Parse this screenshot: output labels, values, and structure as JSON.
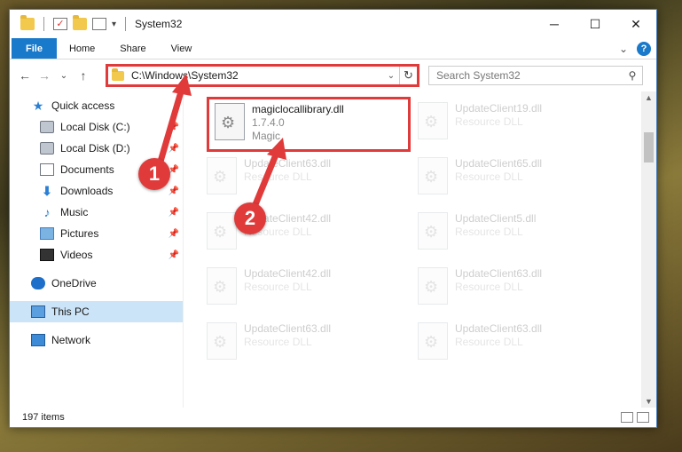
{
  "window": {
    "title": "System32",
    "controls": {
      "minimize": "─",
      "maximize": "☐",
      "close": "✕"
    }
  },
  "ribbon": {
    "tabs": [
      "File",
      "Home",
      "Share",
      "View"
    ],
    "expand": "⌄",
    "help": "?"
  },
  "address": {
    "path": "C:\\Windows\\System32",
    "refresh": "↻",
    "dropdown": "⌄"
  },
  "search": {
    "placeholder": "Search System32",
    "icon": "⚲"
  },
  "nav_buttons": {
    "back": "←",
    "forward": "→",
    "recent": "⌄",
    "up": "↑"
  },
  "sidebar": {
    "quick_access": "Quick access",
    "items": [
      {
        "label": "Local Disk (C:)",
        "icon": "drive-icon"
      },
      {
        "label": "Local Disk (D:)",
        "icon": "drive-icon"
      },
      {
        "label": "Documents",
        "icon": "documents-icon"
      },
      {
        "label": "Downloads",
        "icon": "downloads-icon"
      },
      {
        "label": "Music",
        "icon": "music-icon"
      },
      {
        "label": "Pictures",
        "icon": "pictures-icon"
      },
      {
        "label": "Videos",
        "icon": "videos-icon"
      }
    ],
    "onedrive": "OneDrive",
    "this_pc": "This PC",
    "network": "Network",
    "pin": "📌"
  },
  "files": [
    {
      "name": "magiclocallibrary.dll",
      "version": "1.7.4.0",
      "company": "Magic",
      "highlight": true
    },
    {
      "name": "UpdateClient19.dll",
      "type": "Resource DLL"
    },
    {
      "name": "UpdateClient63.dll",
      "type": "Resource DLL"
    },
    {
      "name": "UpdateClient65.dll",
      "type": "Resource DLL"
    },
    {
      "name": "UpdateClient42.dll",
      "type": "Resource DLL"
    },
    {
      "name": "UpdateClient5.dll",
      "type": "Resource DLL"
    },
    {
      "name": "UpdateClient42.dll",
      "type": "Resource DLL"
    },
    {
      "name": "UpdateClient63.dll",
      "type": "Resource DLL"
    },
    {
      "name": "UpdateClient63.dll",
      "type": "Resource DLL"
    },
    {
      "name": "UpdateClient63.dll",
      "type": "Resource DLL"
    }
  ],
  "status": {
    "count": "197 items"
  },
  "annotations": {
    "step1": "1",
    "step2": "2"
  },
  "colors": {
    "accent": "#1979ca",
    "annotation": "#e03a3a",
    "selected": "#cce4f7"
  }
}
